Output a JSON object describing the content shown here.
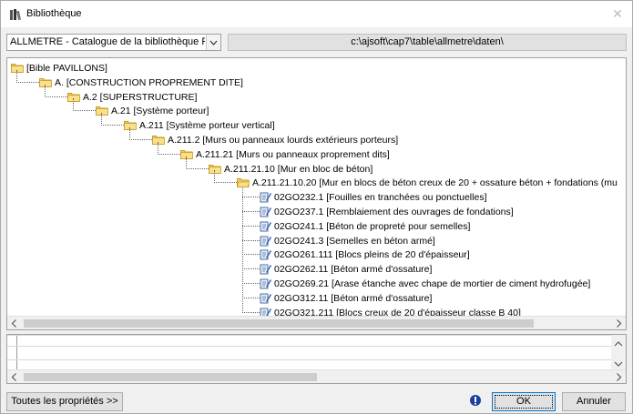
{
  "window": {
    "title": "Bibliothèque",
    "close_glyph": "✕",
    "icon": "library-icon"
  },
  "toolbar": {
    "catalog_select_value": "ALLMETRE - Catalogue de la bibliothèque P",
    "path": "c:\\ajsoft\\cap7\\table\\allmetre\\daten\\"
  },
  "tree": {
    "nodes": [
      {
        "label": "[Bible PAVILLONS]",
        "icon": "folder-icon"
      },
      {
        "label": "A. [CONSTRUCTION PROPREMENT DITE]",
        "icon": "folder-icon"
      },
      {
        "label": "A.2 [SUPERSTRUCTURE]",
        "icon": "folder-icon"
      },
      {
        "label": "A.21 [Système porteur]",
        "icon": "folder-icon"
      },
      {
        "label": "A.211 [Système porteur vertical]",
        "icon": "folder-icon"
      },
      {
        "label": "A.211.2 [Murs ou panneaux lourds extérieurs porteurs]",
        "icon": "folder-icon"
      },
      {
        "label": "A.211.21 [Murs ou panneaux proprement dits]",
        "icon": "folder-icon"
      },
      {
        "label": "A.211.21.10 [Mur en bloc de béton]",
        "icon": "folder-icon"
      },
      {
        "label": "A.211.21.10.20 [Mur en blocs de béton creux de 20 + ossature béton + fondations (mu",
        "icon": "folder-open-icon"
      }
    ],
    "items": [
      {
        "label": "02GO232.1 [Fouilles en tranchées ou ponctuelles]",
        "icon": "document-edit-icon"
      },
      {
        "label": "02GO237.1 [Remblaiement des ouvrages de fondations]",
        "icon": "document-edit-icon"
      },
      {
        "label": "02GO241.1 [Béton de propreté pour semelles]",
        "icon": "document-edit-icon"
      },
      {
        "label": "02GO241.3 [Semelles en béton armé]",
        "icon": "document-edit-icon"
      },
      {
        "label": "02GO261.111 [Blocs pleins de 20 d'épaisseur]",
        "icon": "document-edit-icon"
      },
      {
        "label": "02GO262.11 [Béton armé d'ossature]",
        "icon": "document-edit-icon"
      },
      {
        "label": "02GO269.21 [Arase étanche avec chape de mortier de ciment hydrofugée]",
        "icon": "document-edit-icon"
      },
      {
        "label": "02GO312.11 [Béton armé d'ossature]",
        "icon": "document-edit-icon"
      },
      {
        "label": "02GO321.211 [Blocs creux de 20 d'épaisseur classe B 40]",
        "icon": "document-edit-icon"
      }
    ]
  },
  "scroll": {
    "left": "<",
    "right": ">",
    "up": "^",
    "down": "v"
  },
  "footer": {
    "properties_button": "Toutes les propriétés >>",
    "info_icon": "info-icon",
    "ok_button": "OK",
    "cancel_button": "Annuler"
  },
  "colors": {
    "folder": "#f5cd5b",
    "folder_border": "#c89b2c",
    "selection_border": "#0078d7"
  }
}
